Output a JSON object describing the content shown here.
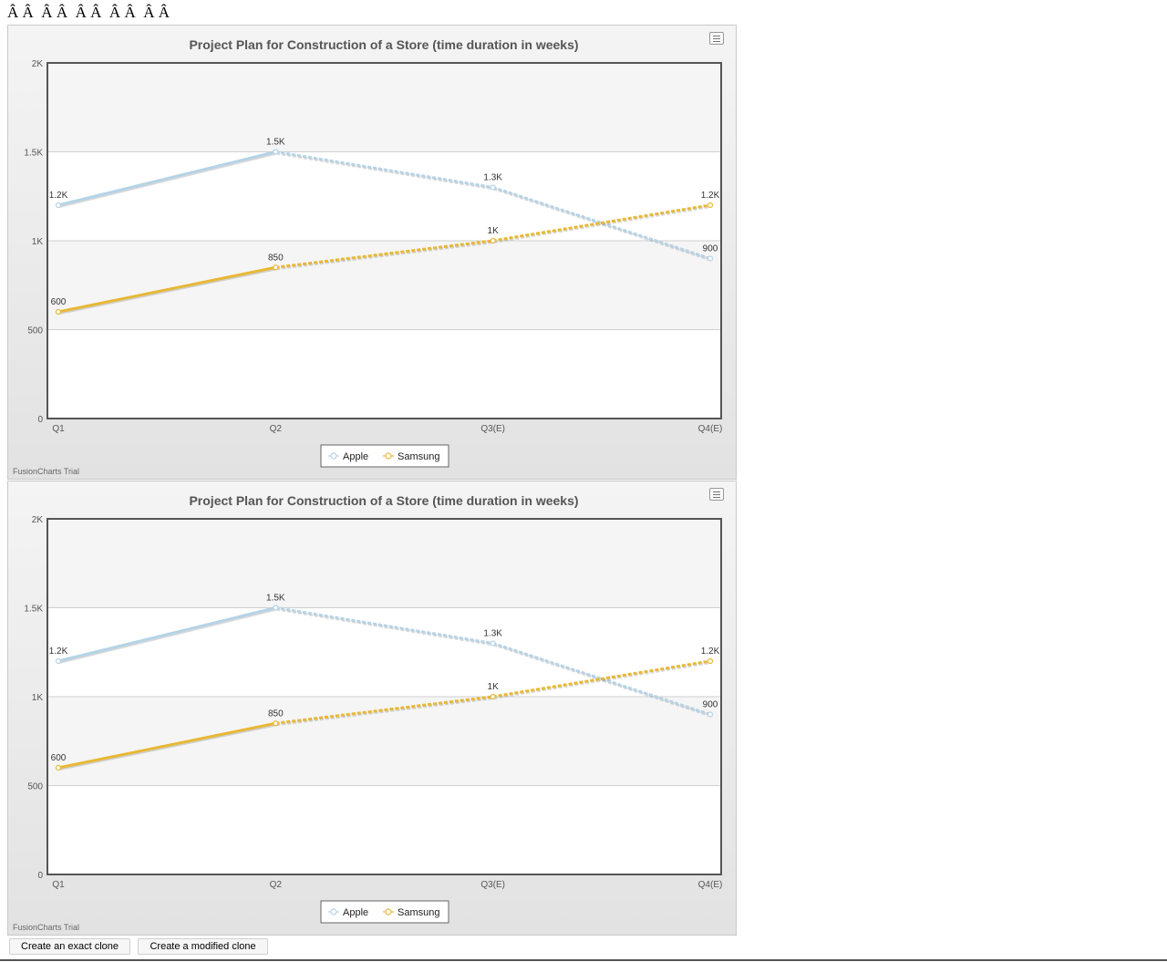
{
  "page": {
    "garbled_heading": "Â Â  Â Â  Â Â  Â Â  Â Â",
    "buttons": {
      "exact_clone": "Create an exact clone",
      "modified_clone": "Create a modified clone"
    }
  },
  "colors": {
    "apple": "#b5d3e6",
    "samsung": "#e8b835",
    "plot_band": "#f5f5f5",
    "canvas_bg": "#e6e6e6",
    "title": "#555555"
  },
  "icons": {
    "export_menu": "hamburger-menu-icon",
    "legend_marker": "circle-line-marker-icon"
  },
  "chart_data": [
    {
      "type": "line",
      "title": "Project Plan for Construction of a Store (time duration in weeks)",
      "categories": [
        "Q1",
        "Q2",
        "Q3(E)",
        "Q4(E)"
      ],
      "dashed_from_index": 1,
      "series": [
        {
          "name": "Apple",
          "values": [
            1200,
            1500,
            1300,
            900
          ],
          "labels": [
            "1.2K",
            "1.5K",
            "1.3K",
            "900"
          ]
        },
        {
          "name": "Samsung",
          "values": [
            600,
            850,
            1000,
            1200
          ],
          "labels": [
            "600",
            "850",
            "1K",
            "1.2K"
          ]
        }
      ],
      "ylim": [
        0,
        2000
      ],
      "yticks": [
        0,
        500,
        1000,
        1500,
        2000
      ],
      "ytick_labels": [
        "0",
        "500",
        "1K",
        "1.5K",
        "2K"
      ],
      "grid": true,
      "legend_position": "bottom",
      "watermark": "FusionCharts Trial"
    },
    {
      "type": "line",
      "title": "Project Plan for Construction of a Store (time duration in weeks)",
      "categories": [
        "Q1",
        "Q2",
        "Q3(E)",
        "Q4(E)"
      ],
      "dashed_from_index": 1,
      "series": [
        {
          "name": "Apple",
          "values": [
            1200,
            1500,
            1300,
            900
          ],
          "labels": [
            "1.2K",
            "1.5K",
            "1.3K",
            "900"
          ]
        },
        {
          "name": "Samsung",
          "values": [
            600,
            850,
            1000,
            1200
          ],
          "labels": [
            "600",
            "850",
            "1K",
            "1.2K"
          ]
        }
      ],
      "ylim": [
        0,
        2000
      ],
      "yticks": [
        0,
        500,
        1000,
        1500,
        2000
      ],
      "ytick_labels": [
        "0",
        "500",
        "1K",
        "1.5K",
        "2K"
      ],
      "grid": true,
      "legend_position": "bottom",
      "watermark": "FusionCharts Trial"
    }
  ]
}
